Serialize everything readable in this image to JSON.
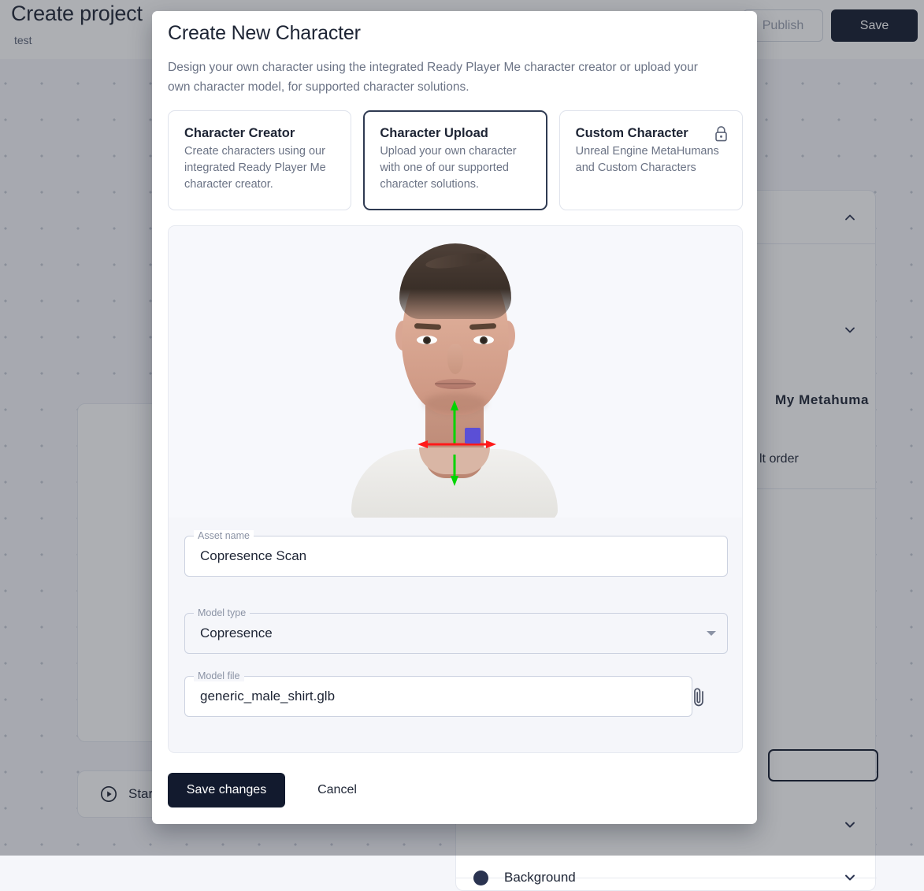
{
  "background": {
    "page_title": "Create project",
    "page_subtitle": "test",
    "publish_label": "Publish",
    "save_label": "Save",
    "metahuman_label": "My Metahuma",
    "order_label": "lt order",
    "start_label": "Star",
    "bottom_label": "Background"
  },
  "modal": {
    "title": "Create New Character",
    "description": "Design your own character using the integrated Ready Player Me character creator or upload your own character model, for supported character solutions.",
    "options": [
      {
        "title": "Character Creator",
        "description": "Create characters using our integrated Ready Player Me character creator.",
        "selected": false,
        "locked": false
      },
      {
        "title": "Character Upload",
        "description": "Upload your own character with one of our supported character solutions.",
        "selected": true,
        "locked": false
      },
      {
        "title": "Custom Character",
        "description": "Unreal Engine MetaHumans and Custom Characters",
        "selected": false,
        "locked": true
      }
    ],
    "form": {
      "asset_name_label": "Asset name",
      "asset_name_value": "Copresence Scan",
      "model_type_label": "Model type",
      "model_type_value": "Copresence",
      "model_file_label": "Model file",
      "model_file_value": "generic_male_shirt.glb"
    },
    "footer": {
      "save_changes_label": "Save changes",
      "cancel_label": "Cancel"
    }
  },
  "colors": {
    "primary_dark": "#121a2e",
    "panel_bg": "#f5f6fa",
    "border": "#dfe3ec",
    "selected_border": "#2f3a52",
    "muted_text": "#6b7385",
    "gizmo_x_axis": "#ff1a1a",
    "gizmo_y_axis": "#00d400",
    "gizmo_handle": "#5b4fd6"
  }
}
